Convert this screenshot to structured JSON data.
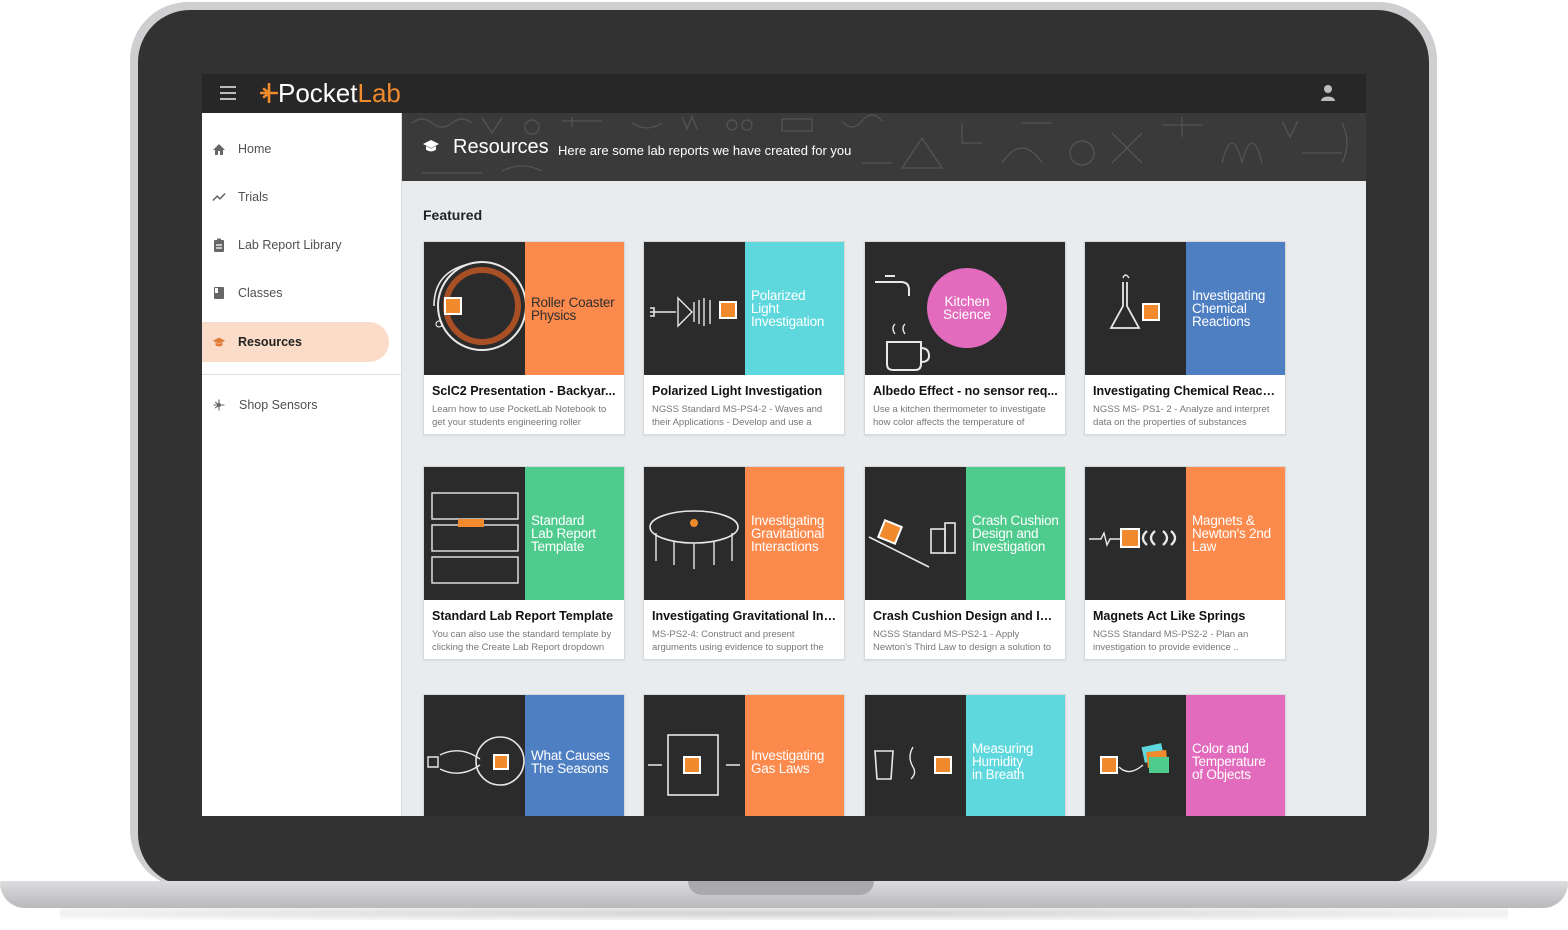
{
  "app": {
    "logo_a": "Pocket",
    "logo_b": "Lab"
  },
  "sidebar": {
    "items": [
      {
        "label": "Home",
        "icon": "home-icon"
      },
      {
        "label": "Trials",
        "icon": "trend-icon"
      },
      {
        "label": "Lab Report Library",
        "icon": "clipboard-icon"
      },
      {
        "label": "Classes",
        "icon": "book-icon"
      },
      {
        "label": "Resources",
        "icon": "graduation-cap-icon",
        "active": true
      },
      {
        "label": "Shop Sensors",
        "icon": "sensor-icon"
      }
    ]
  },
  "banner": {
    "title": "Resources",
    "subtitle": "Here are some lab reports we have created for you"
  },
  "featured_label": "Featured",
  "colors": {
    "accent": "#f08a2c",
    "orange": "#fb8a4c",
    "cyan": "#5ed8dd",
    "blue": "#4e7fc2",
    "green": "#4fcb8e",
    "pink": "#e26bbd",
    "dark": "#2b2b2b"
  },
  "cards": [
    {
      "thumb_text": "Roller Coaster\nPhysics",
      "color": "#fb8a4c",
      "text_style": "mixed",
      "title": "SclC2 Presentation - Backyar...",
      "desc": "Learn how to use PocketLab Notebook to get your students engineering roller"
    },
    {
      "thumb_text": "Polarized\nLight\nInvestigation",
      "color": "#5ed8dd",
      "title": "Polarized Light Investigation",
      "desc": "NGSS Standard MS-PS4-2 - Waves and their Applications - Develop and use a"
    },
    {
      "thumb_text": "Kitchen\nScience",
      "color": "#2b2b2b",
      "circle": true,
      "title": "Albedo Effect - no sensor req...",
      "desc": "Use a kitchen thermometer to investigate how color affects the temperature of"
    },
    {
      "thumb_text": "Investigating\nChemical\nReactions",
      "color": "#4e7fc2",
      "title": "Investigating Chemical Reacti...",
      "desc": "NGSS MS- PS1- 2 - Analyze and interpret data on the properties of substances"
    },
    {
      "thumb_text": "Standard\nLab Report\nTemplate",
      "color": "#4fcb8e",
      "title": "Standard Lab Report Template",
      "desc": "You can also use the standard template by clicking the Create Lab Report dropdown"
    },
    {
      "thumb_text": "Investigating\nGravitational\nInteractions",
      "color": "#fb8a4c",
      "title": "Investigating Gravitational Int...",
      "desc": "MS-PS2-4: Construct and present arguments using evidence to support the"
    },
    {
      "thumb_text": "Crash Cushion\nDesign and\nInvestigation",
      "color": "#4fcb8e",
      "title": "Crash Cushion Design and Inv...",
      "desc": "NGSS Standard MS-PS2-1 - Apply Newton's Third Law to design a solution to"
    },
    {
      "thumb_text": "Magnets &\nNewton's 2nd\nLaw",
      "color": "#fb8a4c",
      "title": "Magnets Act Like Springs",
      "desc": "NGSS Standard MS-PS2-2 - Plan an investigation to provide evidence .."
    },
    {
      "thumb_text": "What Causes\nThe Seasons",
      "color": "#4e7fc2",
      "title": "",
      "desc": ""
    },
    {
      "thumb_text": "Investigating\nGas Laws",
      "color": "#fb8a4c",
      "title": "",
      "desc": ""
    },
    {
      "thumb_text": "Measuring\nHumidity\nin Breath",
      "color": "#5ed8dd",
      "title": "",
      "desc": ""
    },
    {
      "thumb_text": "Color and\nTemperature\nof Objects",
      "color": "#e26bbd",
      "title": "",
      "desc": ""
    }
  ]
}
